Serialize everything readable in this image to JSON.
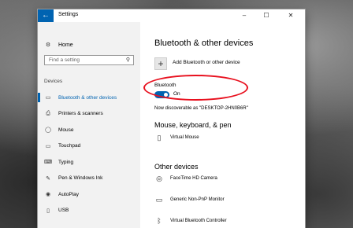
{
  "window": {
    "title": "Settings",
    "back_icon": "back-arrow-icon",
    "controls": [
      "–",
      "☐",
      "✕"
    ]
  },
  "sidebar": {
    "home_label": "Home",
    "search_placeholder": "Find a setting",
    "section_label": "Devices",
    "items": [
      {
        "label": "Bluetooth & other devices",
        "icon": "bluetooth-devices-icon",
        "active": true
      },
      {
        "label": "Printers & scanners",
        "icon": "printer-icon"
      },
      {
        "label": "Mouse",
        "icon": "mouse-icon"
      },
      {
        "label": "Touchpad",
        "icon": "touchpad-icon"
      },
      {
        "label": "Typing",
        "icon": "keyboard-icon"
      },
      {
        "label": "Pen & Windows Ink",
        "icon": "pen-icon"
      },
      {
        "label": "AutoPlay",
        "icon": "autoplay-icon"
      },
      {
        "label": "USB",
        "icon": "usb-icon"
      }
    ]
  },
  "main": {
    "title": "Bluetooth & other devices",
    "add_device_label": "Add Bluetooth or other device",
    "bluetooth_label": "Bluetooth",
    "bluetooth_state": "On",
    "discoverable_text": "Now discoverable as \"DESKTOP-2HN0B6R\"",
    "mouse_section_title": "Mouse, keyboard, & pen",
    "mouse_devices": [
      {
        "name": "Virtual Mouse",
        "icon": "mouse-icon"
      }
    ],
    "other_section_title": "Other devices",
    "other_devices": [
      {
        "name": "FaceTime HD Camera",
        "icon": "camera-icon"
      },
      {
        "name": "Generic Non-PnP Monitor",
        "icon": "monitor-icon"
      },
      {
        "name": "Virtual Bluetooth Controller",
        "icon": "bluetooth-icon"
      }
    ]
  },
  "colors": {
    "accent": "#0063b1",
    "highlight": "#e8101e"
  }
}
